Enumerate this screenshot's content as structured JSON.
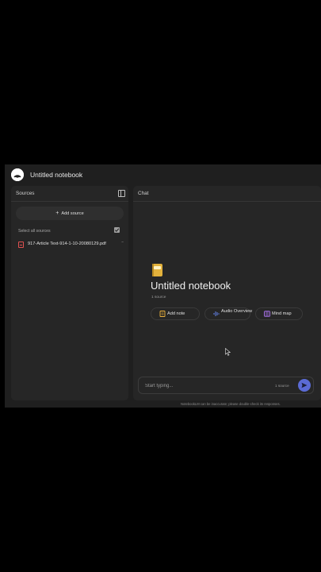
{
  "app": {
    "title": "Untitled notebook",
    "logo_icon": "notebooklm-logo-icon"
  },
  "sources_panel": {
    "header": "Sources",
    "add_source_label": "Add source",
    "select_all_label": "Select all sources",
    "select_all_checked": true,
    "items": [
      {
        "name": "917-Article Text-914-1-10-20080129.pdf",
        "icon": "pdf-icon",
        "checked": true
      }
    ]
  },
  "chat_panel": {
    "header": "Chat",
    "notebook_title": "Untitled notebook",
    "source_count": "1 source",
    "actions": [
      {
        "label": "Add note",
        "icon": "note-icon"
      },
      {
        "label": "Audio Overview",
        "icon": "audio-waveform-icon"
      },
      {
        "label": "Mind map",
        "icon": "mind-map-icon"
      }
    ],
    "input_placeholder": "Start typing...",
    "input_source_count": "1 source",
    "disclaimer": "NotebookLM can be inaccurate; please double-check its responses."
  },
  "colors": {
    "accent": "#5b6bd5",
    "background": "#1f1f1f",
    "panel": "#262626",
    "pdf": "#e05050",
    "note_icon": "#f0b43c",
    "audio_icon": "#6b8cff",
    "mindmap_icon": "#b77bff"
  }
}
